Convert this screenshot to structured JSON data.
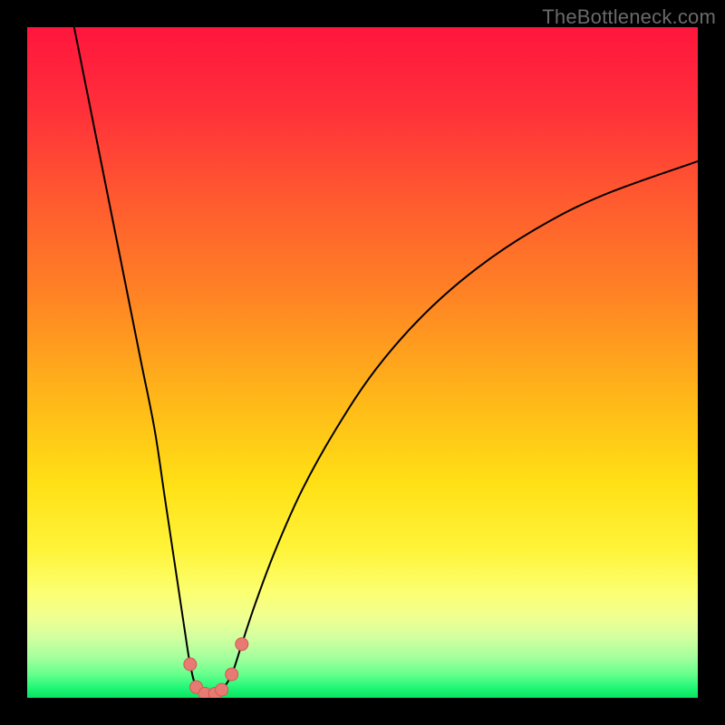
{
  "watermark": "TheBottleneck.com",
  "colors": {
    "bg": "#000000",
    "curve": "#000000",
    "marker_fill": "#e77a72",
    "marker_stroke": "#d15a52",
    "gradient_stops": [
      {
        "offset": "0%",
        "color": "#ff163d"
      },
      {
        "offset": "12%",
        "color": "#ff2f3a"
      },
      {
        "offset": "25%",
        "color": "#ff5830"
      },
      {
        "offset": "40%",
        "color": "#ff8324"
      },
      {
        "offset": "55%",
        "color": "#ffb619"
      },
      {
        "offset": "68%",
        "color": "#ffe015"
      },
      {
        "offset": "78%",
        "color": "#fff43a"
      },
      {
        "offset": "84%",
        "color": "#fcff6e"
      },
      {
        "offset": "88%",
        "color": "#f0ff91"
      },
      {
        "offset": "91%",
        "color": "#d2ffa0"
      },
      {
        "offset": "94%",
        "color": "#a4ff9d"
      },
      {
        "offset": "96.5%",
        "color": "#66ff8d"
      },
      {
        "offset": "98.5%",
        "color": "#22f777"
      },
      {
        "offset": "100%",
        "color": "#07e362"
      }
    ]
  },
  "chart_data": {
    "type": "line",
    "title": "",
    "xlabel": "",
    "ylabel": "",
    "xlim": [
      0,
      100
    ],
    "ylim": [
      0,
      100
    ],
    "left_branch": [
      {
        "x": 7,
        "y": 100
      },
      {
        "x": 9,
        "y": 90
      },
      {
        "x": 11,
        "y": 80
      },
      {
        "x": 13,
        "y": 70
      },
      {
        "x": 15,
        "y": 60
      },
      {
        "x": 17,
        "y": 50
      },
      {
        "x": 19,
        "y": 40
      },
      {
        "x": 20.5,
        "y": 30
      },
      {
        "x": 22,
        "y": 20
      },
      {
        "x": 23.5,
        "y": 10
      },
      {
        "x": 24.3,
        "y": 5
      },
      {
        "x": 25.2,
        "y": 1.6
      },
      {
        "x": 26.5,
        "y": 0.6
      },
      {
        "x": 28,
        "y": 0.6
      }
    ],
    "right_branch": [
      {
        "x": 28,
        "y": 0.6
      },
      {
        "x": 29,
        "y": 1.2
      },
      {
        "x": 30.5,
        "y": 3.5
      },
      {
        "x": 32,
        "y": 8
      },
      {
        "x": 34,
        "y": 14
      },
      {
        "x": 37,
        "y": 22
      },
      {
        "x": 41,
        "y": 31
      },
      {
        "x": 46,
        "y": 40
      },
      {
        "x": 52,
        "y": 49
      },
      {
        "x": 59,
        "y": 57
      },
      {
        "x": 67,
        "y": 64
      },
      {
        "x": 76,
        "y": 70
      },
      {
        "x": 86,
        "y": 75
      },
      {
        "x": 100,
        "y": 80
      }
    ],
    "markers": [
      {
        "x": 24.3,
        "y": 5.0
      },
      {
        "x": 25.2,
        "y": 1.6
      },
      {
        "x": 26.5,
        "y": 0.6
      },
      {
        "x": 28.0,
        "y": 0.6
      },
      {
        "x": 29.0,
        "y": 1.2
      },
      {
        "x": 30.5,
        "y": 3.5
      },
      {
        "x": 32.0,
        "y": 8.0
      }
    ]
  }
}
